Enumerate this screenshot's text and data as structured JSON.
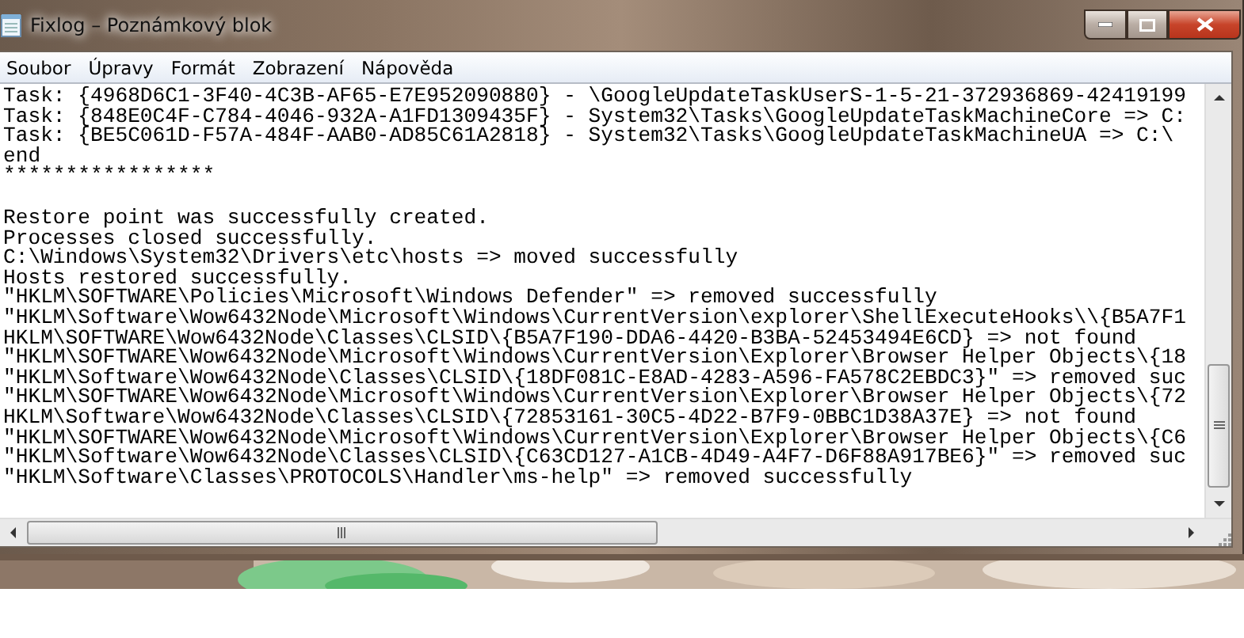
{
  "window": {
    "title": "Fixlog – Poznámkový blok"
  },
  "menu": [
    "Soubor",
    "Úpravy",
    "Formát",
    "Zobrazení",
    "Nápověda"
  ],
  "editor": {
    "blocks": [
      [
        "Task: {4968D6C1-3F40-4C3B-AF65-E7E952090880} - \\GoogleUpdateTaskUserS-1-5-21-372936869-42419199",
        "Task: {848E0C4F-C784-4046-932A-A1FD1309435F} - System32\\Tasks\\GoogleUpdateTaskMachineCore => C:",
        "Task: {BE5C061D-F57A-484F-AAB0-AD85C61A2818} - System32\\Tasks\\GoogleUpdateTaskMachineUA => C:\\",
        "end",
        "*****************"
      ],
      [
        "Restore point was successfully created.",
        "Processes closed successfully.",
        "C:\\Windows\\System32\\Drivers\\etc\\hosts => moved successfully",
        "Hosts restored successfully.",
        "\"HKLM\\SOFTWARE\\Policies\\Microsoft\\Windows Defender\" => removed successfully",
        "\"HKLM\\Software\\Wow6432Node\\Microsoft\\Windows\\CurrentVersion\\explorer\\ShellExecuteHooks\\\\{B5A7F1",
        "HKLM\\SOFTWARE\\Wow6432Node\\Classes\\CLSID\\{B5A7F190-DDA6-4420-B3BA-52453494E6CD} => not found",
        "\"HKLM\\SOFTWARE\\Wow6432Node\\Microsoft\\Windows\\CurrentVersion\\Explorer\\Browser Helper Objects\\{18",
        "\"HKLM\\Software\\Wow6432Node\\Classes\\CLSID\\{18DF081C-E8AD-4283-A596-FA578C2EBDC3}\" => removed suc",
        "\"HKLM\\SOFTWARE\\Wow6432Node\\Microsoft\\Windows\\CurrentVersion\\Explorer\\Browser Helper Objects\\{72",
        "HKLM\\Software\\Wow6432Node\\Classes\\CLSID\\{72853161-30C5-4D22-B7F9-0BBC1D38A37E} => not found",
        "\"HKLM\\SOFTWARE\\Wow6432Node\\Microsoft\\Windows\\CurrentVersion\\Explorer\\Browser Helper Objects\\{C6",
        "\"HKLM\\Software\\Wow6432Node\\Classes\\CLSID\\{C63CD127-A1CB-4D49-A4F7-D6F88A917BE6}\" => removed suc",
        "\"HKLM\\Software\\Classes\\PROTOCOLS\\Handler\\ms-help\" => removed successfully"
      ]
    ]
  }
}
